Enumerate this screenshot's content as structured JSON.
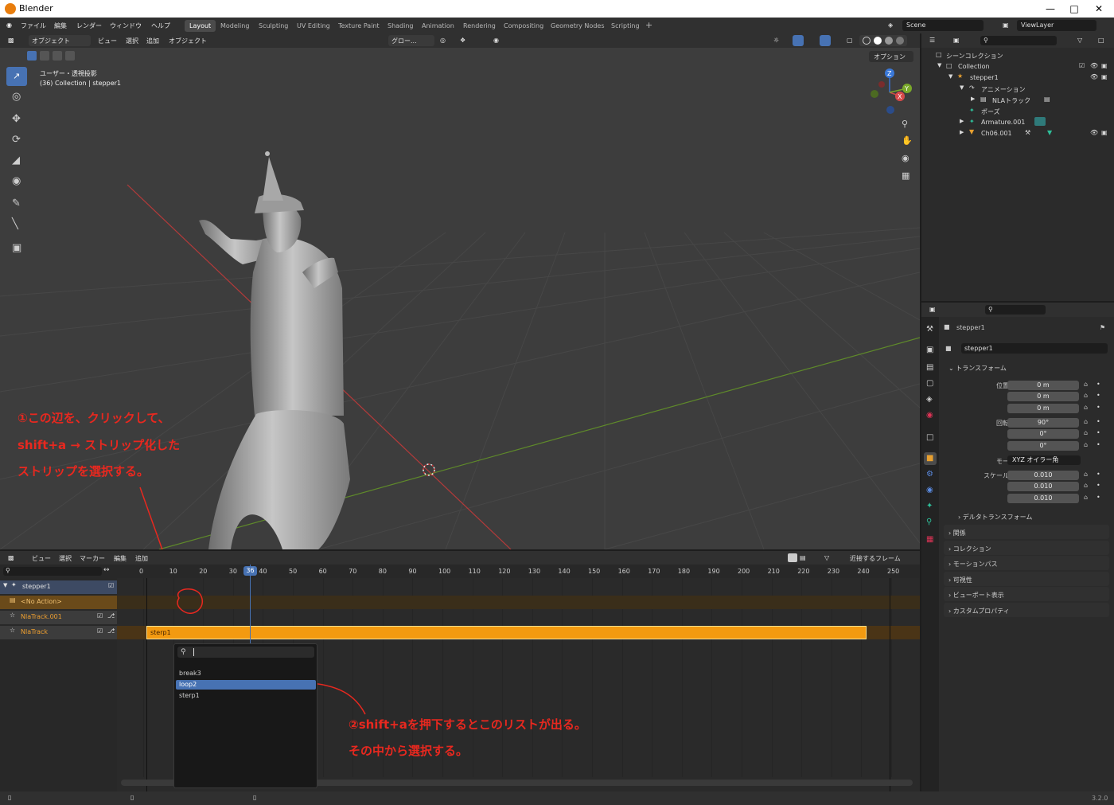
{
  "window": {
    "title": "Blender"
  },
  "menu": [
    "ファイル",
    "編集",
    "レンダー",
    "ウィンドウ",
    "ヘルプ"
  ],
  "workspaces": [
    "Layout",
    "Modeling",
    "Sculpting",
    "UV Editing",
    "Texture Paint",
    "Shading",
    "Animation",
    "Rendering",
    "Compositing",
    "Geometry Nodes",
    "Scripting"
  ],
  "active_workspace": "Layout",
  "scene": "Scene",
  "view_layer": "ViewLayer",
  "viewport": {
    "mode": "オブジェクト",
    "menus": [
      "ビュー",
      "選択",
      "追加",
      "オブジェクト"
    ],
    "transform_orientation": "グロー...",
    "overlay_line1": "ユーザー・透視投影",
    "overlay_line2": "(36) Collection | stepper1",
    "options_label": "オプション",
    "axis": {
      "x": "X",
      "y": "Y",
      "z": "Z"
    }
  },
  "annotations": {
    "a1_line1": "①この辺を、クリックして、",
    "a1_line2": "shift+a → ストリップ化した",
    "a1_line3": "ストリップを選択する。",
    "a2_line1": "②shift+aを押下するとこのリストが出る。",
    "a2_line2": "その中から選択する。"
  },
  "outliner": {
    "rows": [
      {
        "label": "シーンコレクション"
      },
      {
        "label": "Collection"
      },
      {
        "label": "stepper1"
      },
      {
        "label": "アニメーション"
      },
      {
        "label": "NLAトラック"
      },
      {
        "label": "ポーズ"
      },
      {
        "label": "Armature.001"
      },
      {
        "label": "Ch06.001"
      }
    ]
  },
  "properties": {
    "object_name": "stepper1",
    "data_name": "stepper1",
    "transform_label": "トランスフォーム",
    "location_label": "位置 X",
    "rotation_label": "回転 X",
    "scale_label": "スケール X",
    "y_label": "Y",
    "z_label": "Z",
    "location": [
      "0 m",
      "0 m",
      "0 m"
    ],
    "rotation": [
      "90°",
      "0°",
      "0°"
    ],
    "mode_label": "モード",
    "mode_value": "XYZ オイラー角",
    "scale": [
      "0.010",
      "0.010",
      "0.010"
    ],
    "sections": [
      "デルタトランスフォーム",
      "関係",
      "コレクション",
      "モーションパス",
      "可視性",
      "ビューポート表示",
      "カスタムプロパティ"
    ]
  },
  "nla": {
    "menus": [
      "ビュー",
      "選択",
      "マーカー",
      "編集",
      "追加"
    ],
    "snap": "近接するフレーム",
    "current_frame": "36",
    "ticks": [
      "0",
      "10",
      "20",
      "30",
      "40",
      "50",
      "60",
      "70",
      "80",
      "90",
      "100",
      "110",
      "120",
      "130",
      "140",
      "150",
      "160",
      "170",
      "180",
      "190",
      "200",
      "210",
      "220",
      "230",
      "240",
      "250"
    ],
    "channels": [
      "stepper1",
      "<No Action>",
      "NlaTrack.001",
      "NlaTrack"
    ],
    "strip_name": "sterp1",
    "popup_items": [
      "break3",
      "loop2",
      "sterp1"
    ],
    "popup_selected": "loop2"
  },
  "status": {
    "version": "3.2.0"
  }
}
